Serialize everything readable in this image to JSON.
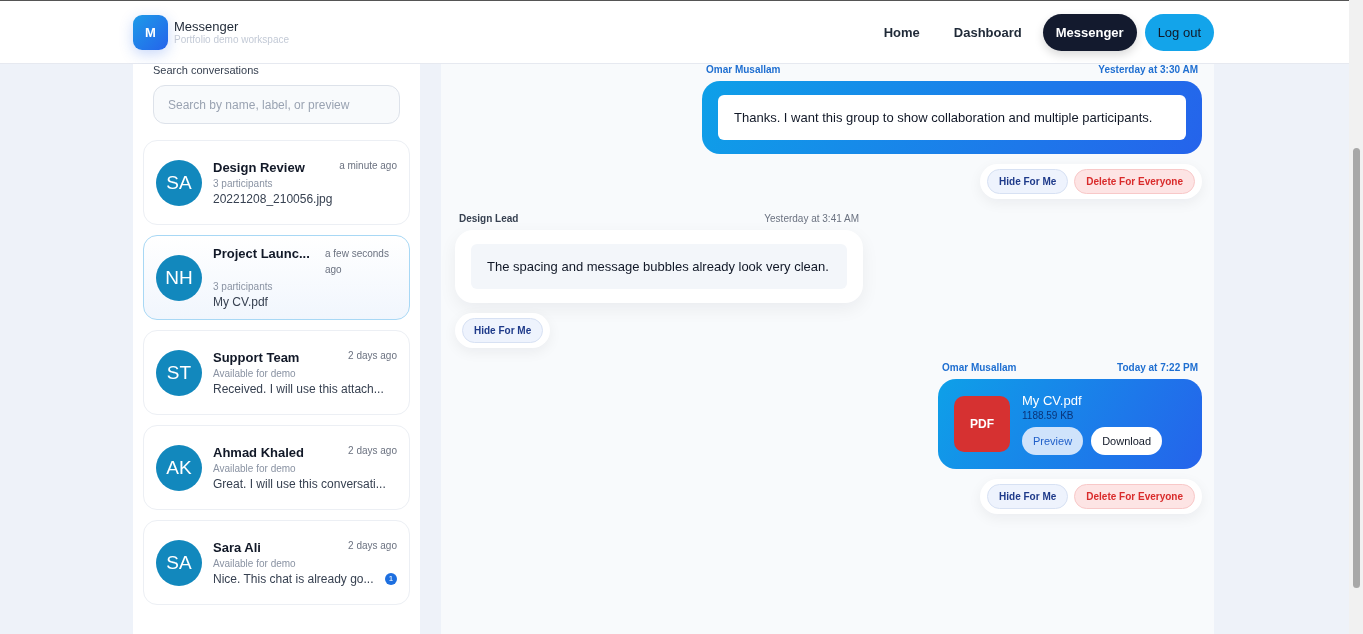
{
  "header": {
    "logo_letter": "M",
    "title": "Messenger",
    "subtitle": "Portfolio demo workspace",
    "nav": [
      {
        "label": "Home",
        "selected": false
      },
      {
        "label": "Dashboard",
        "selected": false
      },
      {
        "label": "Messenger",
        "selected": true
      }
    ],
    "logout": "Log out"
  },
  "sidebar": {
    "search_label": "Search conversations",
    "search": {
      "placeholder": "Search by name, label, or preview"
    },
    "conversations": [
      {
        "initials": "SA",
        "name": "Design Review",
        "time": "a minute ago",
        "subtitle": "3 participants",
        "preview": "20221208_210056.jpg",
        "selected": false
      },
      {
        "initials": "NH",
        "name": "Project Launc...",
        "time": "a few seconds ago",
        "subtitle": "3 participants",
        "preview": "My CV.pdf",
        "selected": true
      },
      {
        "initials": "ST",
        "name": "Support Team",
        "time": "2 days ago",
        "subtitle": "Available for demo",
        "preview": "Received. I will use this attach...",
        "selected": false
      },
      {
        "initials": "AK",
        "name": "Ahmad Khaled",
        "time": "2 days ago",
        "subtitle": "Available for demo",
        "preview": "Great. I will use this conversati...",
        "selected": false
      },
      {
        "initials": "SA",
        "name": "Sara Ali",
        "time": "2 days ago",
        "subtitle": "Available for demo",
        "preview": "Nice. This chat is already go...",
        "selected": false,
        "badge": "1"
      }
    ]
  },
  "messages": [
    {
      "kind": "text",
      "outgoing": true,
      "sender": "Omar Musallam",
      "time": "Yesterday at 3:30 AM",
      "text": "Thanks. I want this group to show collaboration and multiple participants.",
      "actions": [
        {
          "kind": "hide",
          "label": "Hide For Me"
        },
        {
          "kind": "delete",
          "label": "Delete For Everyone"
        }
      ]
    },
    {
      "kind": "text",
      "outgoing": false,
      "sender": "Design Lead",
      "time": "Yesterday at 3:41 AM",
      "text": "The spacing and message bubbles already look very clean.",
      "actions": [
        {
          "kind": "hide",
          "label": "Hide For Me"
        }
      ]
    },
    {
      "kind": "file",
      "outgoing": true,
      "sender": "Omar Musallam",
      "time": "Today at 7:22 PM",
      "file_type": "PDF",
      "file_name": "My CV.pdf",
      "file_size": "1188.59 KB",
      "file_buttons": [
        {
          "kind": "preview",
          "label": "Preview"
        },
        {
          "kind": "download",
          "label": "Download"
        }
      ],
      "actions": [
        {
          "kind": "hide",
          "label": "Hide For Me"
        },
        {
          "kind": "delete",
          "label": "Delete For Everyone"
        }
      ]
    }
  ]
}
